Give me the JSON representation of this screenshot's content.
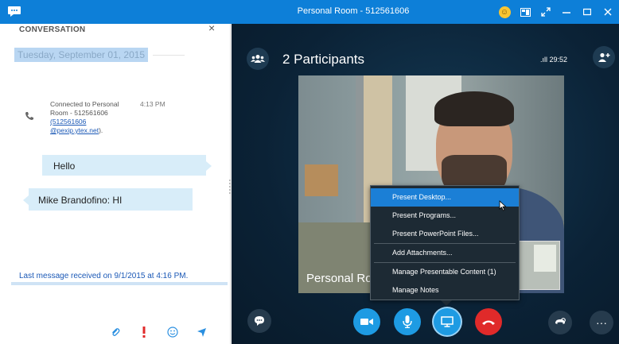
{
  "window": {
    "title": "Personal Room - 512561606"
  },
  "conversation": {
    "header": "CONVERSATION",
    "close_glyph": "×",
    "date": "Tuesday, September 01, 2015",
    "system_message": {
      "line1": "Connected to Personal",
      "line2": "Room - 512561606",
      "link1": "(512561606",
      "link2": "@pexip.ytex.net",
      "suffix": ").",
      "time": "4:13 PM"
    },
    "messages": [
      {
        "text": "Hello"
      },
      {
        "text": "Mike Brandofino: HI"
      }
    ],
    "last_message": "Last message received on 9/1/2015 at 4:16 PM.",
    "compose_placeholder": ""
  },
  "stage": {
    "participants_label": "2 Participants",
    "signal_text": ".ıll  29:52",
    "video_label": "Personal Ro",
    "more_glyph": "···"
  },
  "menu": {
    "items": [
      "Present Desktop...",
      "Present Programs...",
      "Present PowerPoint Files...",
      "Add Attachments...",
      "Manage Presentable Content (1)",
      "Manage Notes"
    ],
    "selected_index": 0
  },
  "colors": {
    "titlebar": "#0d7fd8",
    "stage_bg": "#0b2236",
    "accent": "#1e9be3",
    "hangup": "#e02a2a",
    "link": "#1a58b6",
    "bubble": "#d8edf9"
  }
}
